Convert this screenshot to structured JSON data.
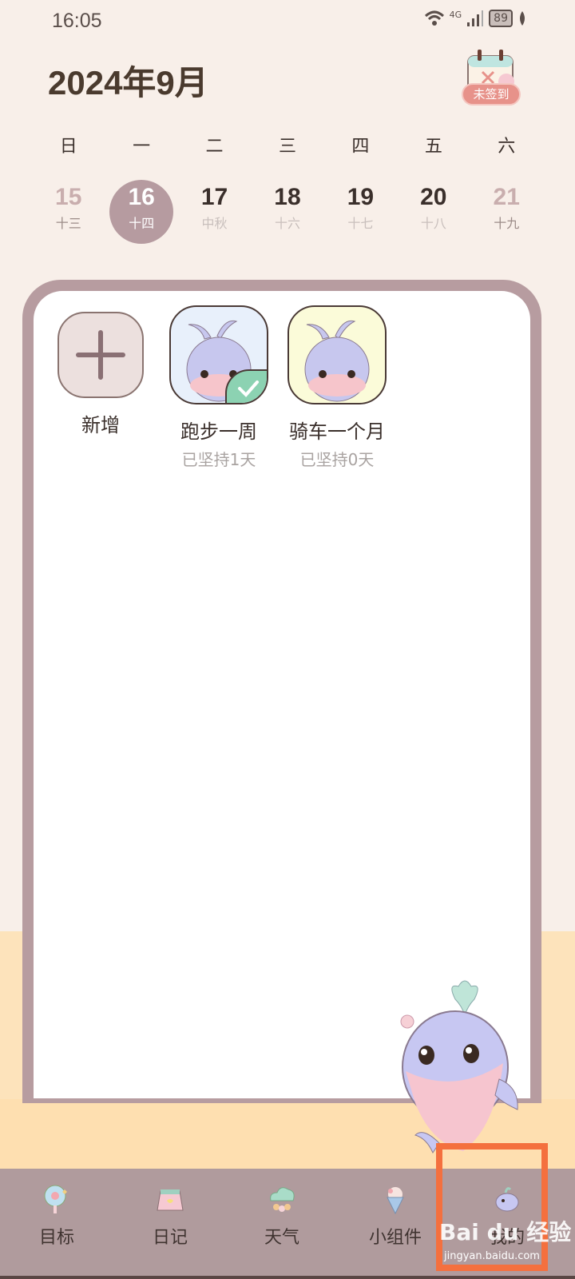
{
  "status_bar": {
    "time": "16:05",
    "network": "4G",
    "battery": "89"
  },
  "header": {
    "title": "2024年9月",
    "checkin_label": "未签到"
  },
  "calendar": {
    "weekdays": [
      "日",
      "一",
      "二",
      "三",
      "四",
      "五",
      "六"
    ],
    "dates": [
      {
        "day": "15",
        "lunar": "十三",
        "selected": false,
        "weekend": true
      },
      {
        "day": "16",
        "lunar": "十四",
        "selected": true,
        "weekend": false
      },
      {
        "day": "17",
        "lunar": "中秋",
        "selected": false,
        "weekend": false
      },
      {
        "day": "18",
        "lunar": "十六",
        "selected": false,
        "weekend": false
      },
      {
        "day": "19",
        "lunar": "十七",
        "selected": false,
        "weekend": false
      },
      {
        "day": "20",
        "lunar": "十八",
        "selected": false,
        "weekend": false
      },
      {
        "day": "21",
        "lunar": "十九",
        "selected": false,
        "weekend": true
      }
    ]
  },
  "goals": {
    "add_label": "新增",
    "items": [
      {
        "name": "跑步一周",
        "progress": "已坚持1天",
        "checked": true,
        "tile_color": "#e8f0fb"
      },
      {
        "name": "骑车一个月",
        "progress": "已坚持0天",
        "checked": false,
        "tile_color": "#fbfbd9"
      }
    ]
  },
  "tabbar": {
    "items": [
      {
        "label": "目标",
        "icon": "lollipop-icon"
      },
      {
        "label": "日记",
        "icon": "diary-icon"
      },
      {
        "label": "天气",
        "icon": "cloud-icon"
      },
      {
        "label": "小组件",
        "icon": "icecream-icon"
      },
      {
        "label": "我的",
        "icon": "whale-icon"
      }
    ]
  },
  "watermark": {
    "brand": "Bai du 经验",
    "url": "jingyan.baidu.com"
  }
}
